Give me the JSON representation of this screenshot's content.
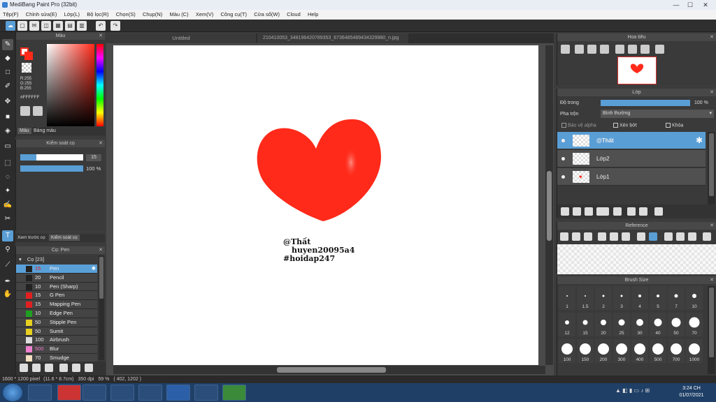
{
  "window": {
    "title": "MediBang Paint Pro (32bit)",
    "controls": [
      "—",
      "☐",
      "✕"
    ]
  },
  "menu": [
    "Tệp(F)",
    "Chỉnh sửa(E)",
    "Lớp(L)",
    "Bộ lọc(R)",
    "Chọn(S)",
    "Chụp(N)",
    "Màu (C)",
    "Xem(V)",
    "Công cụ(T)",
    "Cửa sổ(W)",
    "Cloud",
    "Help"
  ],
  "tabs": {
    "doc1": "Untitled",
    "doc2": "210410053_348196420789353_6736485489434329980_n.jpg"
  },
  "color_panel": {
    "title": "Màu",
    "r": "R:255",
    "g": "G:255",
    "b": "B:255",
    "hex": "#FFFFFF",
    "tab1": "Màu",
    "tab2": "Bảng màu",
    "primary": "#ff2a1a",
    "secondary": "#ffffff"
  },
  "brush_control": {
    "title": "Kiểm soát cọ",
    "size": "15",
    "opacity": "100 %",
    "size_fraction": 0.25,
    "opacity_fraction": 1.0
  },
  "left_tabs": {
    "tab1": "Xem trước cọ",
    "tab2": "Kiểm soát cọ"
  },
  "brush_panel": {
    "title": "Cọ: Pen",
    "group": "Cọ [23]",
    "items": [
      {
        "size": "15",
        "name": "Pen",
        "color": "#222222",
        "selected": true
      },
      {
        "size": "20",
        "name": "Pencil",
        "color": "#222222"
      },
      {
        "size": "10",
        "name": "Pen (Sharp)",
        "color": "#222222"
      },
      {
        "size": "15",
        "name": "G Pen",
        "color": "#e02020"
      },
      {
        "size": "15",
        "name": "Mapping Pen",
        "color": "#e02020"
      },
      {
        "size": "10",
        "name": "Edge Pen",
        "color": "#20a020"
      },
      {
        "size": "50",
        "name": "Stipple Pen",
        "color": "#e8d020"
      },
      {
        "size": "50",
        "name": "Sumit",
        "color": "#e8d020"
      },
      {
        "size": "100",
        "name": "Airbrush",
        "color": "#dddddd"
      },
      {
        "size": "500",
        "name": "Blur",
        "color": "#f080d0"
      },
      {
        "size": "70",
        "name": "Smudge",
        "color": "#f5e0c0"
      }
    ]
  },
  "canvas_text": {
    "line1": "@Thất",
    "line2": "huyen20095a4",
    "line3": "#hoidap247"
  },
  "status": {
    "size": "1600 * 1200 pixel",
    "cm": "(11.6 * 8.7cm)",
    "dpi": "350 dpi",
    "zoom": "59 %",
    "coords": "( 402, 1202 )"
  },
  "navigator": {
    "title": "Hoa tiêu"
  },
  "layer_panel": {
    "title": "Lớp",
    "opacity_label": "Độ trong",
    "opacity_value": "100 %",
    "blend_label": "Pha trộn",
    "blend_value": "Bình thường",
    "alpha_label": "Bảo vệ alpha",
    "clip_label": "Xén bớt",
    "lock_label": "Khóa",
    "layers": [
      {
        "name": "@Thất",
        "selected": true
      },
      {
        "name": "Lớp2"
      },
      {
        "name": "Lớp1"
      }
    ]
  },
  "reference_panel": {
    "title": "Reference"
  },
  "brush_size_panel": {
    "title": "Brush Size",
    "sizes": [
      "1",
      "1.5",
      "2",
      "3",
      "4",
      "5",
      "7",
      "10",
      "12",
      "15",
      "20",
      "25",
      "30",
      "40",
      "50",
      "70",
      "100",
      "150",
      "200",
      "300",
      "400",
      "500",
      "700",
      "1000"
    ]
  },
  "taskbar": {
    "time": "3:24 CH",
    "date": "01/07/2021"
  }
}
